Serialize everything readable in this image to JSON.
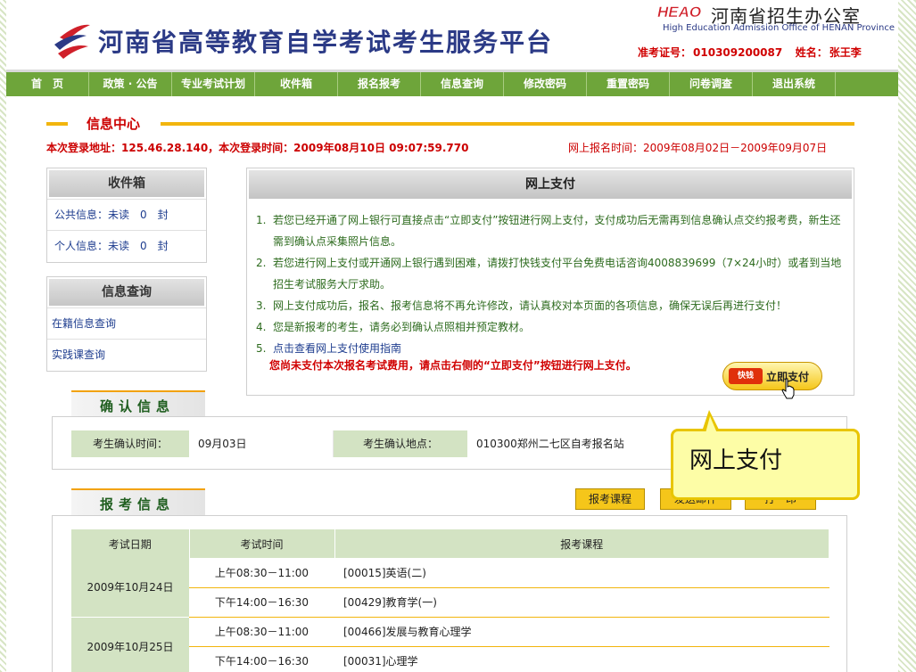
{
  "header": {
    "site_title": "河南省高等教育自学考试考生服务平台",
    "heao_logo": "HEAO",
    "office_cn": "河南省招生办公室",
    "office_en": "High Education Admission Office of HENAN Province",
    "candidate_id_label": "准考证号：",
    "candidate_id": "010309200087",
    "name_label": "姓名：",
    "name": "张王李"
  },
  "nav": {
    "items": [
      "首　页",
      "政策 · 公告",
      "专业考试计划",
      "收件箱",
      "报名报考",
      "信息查询",
      "修改密码",
      "重置密码",
      "问卷调查",
      "退出系统"
    ]
  },
  "info_center": {
    "title": "信息中心",
    "login_info": "本次登录地址：125.46.28.140，本次登录时间：2009年08月10日 09:07:59.770",
    "reg_time": "网上报名时间：2009年08月02日－2009年09月07日"
  },
  "inbox": {
    "title": "收件箱",
    "public": "公共信息：未读　0　封",
    "personal": "个人信息：未读　0　封"
  },
  "query": {
    "title": "信息查询",
    "items": [
      "在籍信息查询",
      "实践课查询"
    ]
  },
  "payment": {
    "title": "网上支付",
    "items": [
      {
        "num": "1.",
        "text": "若您已经开通了网上银行可直接点击“立即支付”按钮进行网上支付，支付成功后无需再到信息确认点交约报考费，新生还需到确认点采集照片信息。"
      },
      {
        "num": "2.",
        "text": "若您进行网上支付或开通网上银行遇到困难，请拨打快钱支付平台免费电话咨询4008839699（7×24小时）或者到当地招生考试服务大厅求助。"
      },
      {
        "num": "3.",
        "text": "网上支付成功后，报名、报考信息将不再允许修改，请认真校对本页面的各项信息，确保无误后再进行支付！"
      },
      {
        "num": "4.",
        "text": "您是新报考的考生，请务必到确认点照相并预定教材。"
      },
      {
        "num": "5.",
        "text": "点击查看网上支付使用指南"
      }
    ],
    "warning": "您尚未支付本次报名考试费用，请点击右侧的“立即支付”按钮进行网上支付。",
    "button_brand": "快钱",
    "button_label": "立即支付"
  },
  "confirm": {
    "title": "确认信息",
    "time_label": "考生确认时间：",
    "time_value": "09月03日",
    "place_label": "考生确认地点：",
    "place_value": "010300郑州二七区自考报名站"
  },
  "tooltip": {
    "text": "网上支付"
  },
  "exam": {
    "title": "报考信息",
    "buttons": [
      "报考课程",
      "发送邮件",
      "打　印"
    ],
    "headers": [
      "考试日期",
      "考试时间",
      "报考课程"
    ],
    "rows": [
      {
        "date": "2009年10月24日",
        "sessions": [
          {
            "time": "上午08:30－11:00",
            "course": "[00015]英语(二)"
          },
          {
            "time": "下午14:00－16:30",
            "course": "[00429]教育学(一)"
          }
        ]
      },
      {
        "date": "2009年10月25日",
        "sessions": [
          {
            "time": "上午08:30－11:00",
            "course": "[00466]发展与教育心理学"
          },
          {
            "time": "下午14:00－16:30",
            "course": "[00031]心理学"
          }
        ]
      }
    ]
  },
  "colors": {
    "nav_green": "#6ea53a",
    "accent_red": "#c00000",
    "accent_yellow": "#f2b50d",
    "title_blue": "#2b3a86"
  }
}
